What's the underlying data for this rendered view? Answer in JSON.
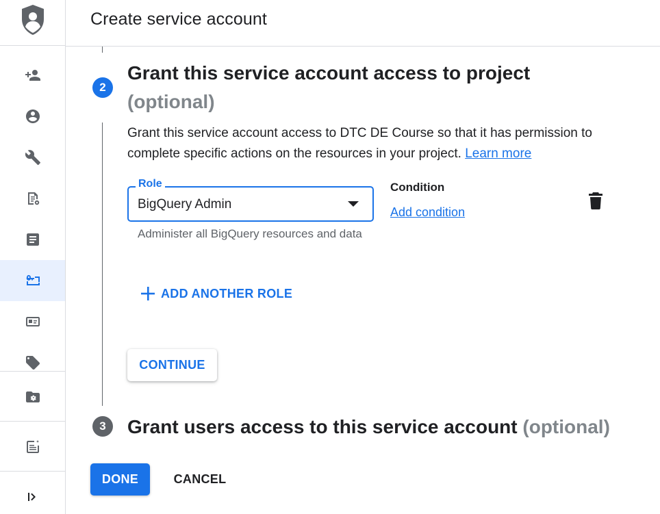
{
  "header": {
    "title": "Create service account"
  },
  "sidebar": {
    "items": [
      {
        "icon": "person-add-icon"
      },
      {
        "icon": "account-circle-icon"
      },
      {
        "icon": "wrench-icon"
      },
      {
        "icon": "policy-document-icon"
      },
      {
        "icon": "article-icon"
      },
      {
        "icon": "service-account-key-icon",
        "active": true
      },
      {
        "icon": "id-card-icon"
      },
      {
        "icon": "label-tag-icon"
      },
      {
        "icon": "folder-settings-icon"
      },
      {
        "icon": "release-notes-icon"
      },
      {
        "icon": "expand-sidebar-icon"
      }
    ]
  },
  "step2": {
    "number": "2",
    "title": "Grant this service account access to project",
    "optional": "(optional)",
    "description": "Grant this service account access to DTC DE Course so that it has permission to complete specific actions on the resources in your project.",
    "learn_more": "Learn more",
    "role": {
      "label": "Role",
      "value": "BigQuery Admin",
      "hint": "Administer all BigQuery resources and data"
    },
    "condition": {
      "label": "Condition",
      "add_link": "Add condition"
    },
    "add_role_label": "ADD ANOTHER ROLE",
    "continue_label": "CONTINUE"
  },
  "step3": {
    "number": "3",
    "title": "Grant users access to this service account",
    "optional": "(optional)"
  },
  "footer": {
    "done_label": "DONE",
    "cancel_label": "CANCEL"
  },
  "colors": {
    "accent": "#1a73e8",
    "inactive_step": "#5f6368",
    "active_nav_bg": "#e8f0fe"
  }
}
